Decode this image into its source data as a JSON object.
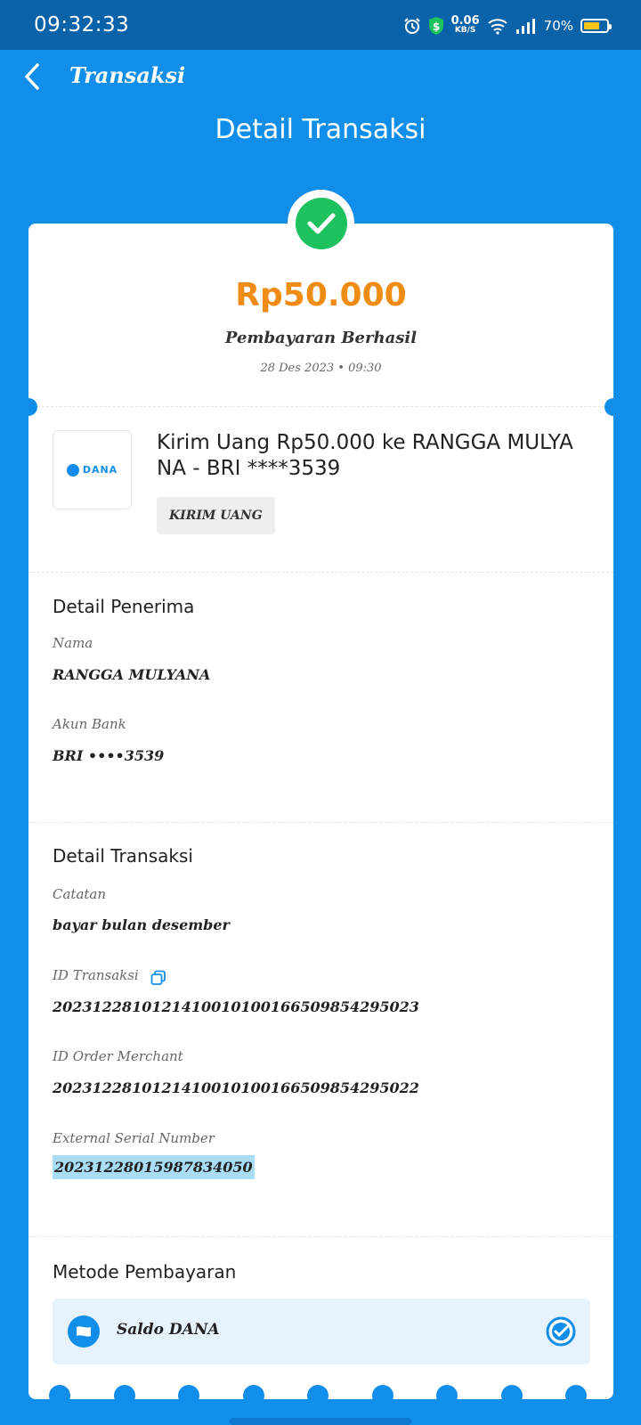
{
  "status_bar": {
    "time": "09:32:33",
    "net_speed_value": "0.06",
    "net_speed_unit": "KB/S",
    "battery": "70%",
    "battery_level": 0.7
  },
  "nav": {
    "title": "Transaksi"
  },
  "page_title": "Detail Transaksi",
  "summary": {
    "amount": "Rp50.000",
    "status": "Pembayaran Berhasil",
    "datetime": "28 Des 2023 • 09:30"
  },
  "merchant": {
    "logo_text": "DANA",
    "description": "Kirim Uang Rp50.000 ke RANGGA MULYANA - BRI ****3539",
    "tag": "KIRIM UANG"
  },
  "recipient": {
    "section_title": "Detail Penerima",
    "name_label": "Nama",
    "name_value": "RANGGA MULYANA",
    "bank_label": "Akun Bank",
    "bank_value": "BRI ••••3539"
  },
  "transaction": {
    "section_title": "Detail Transaksi",
    "note_label": "Catatan",
    "note_value": "bayar bulan desember",
    "id_label": "ID Transaksi",
    "id_value": "2023122810121410010100166509854295023",
    "order_label": "ID Order Merchant",
    "order_value": "2023122810121410010100166509854295022",
    "serial_label": "External Serial Number",
    "serial_value": "20231228015987834050"
  },
  "payment": {
    "section_title": "Metode Pembayaran",
    "method": "Saldo DANA"
  },
  "colors": {
    "primary": "#118eea",
    "amount": "#f08b14",
    "success": "#1dc25f"
  }
}
